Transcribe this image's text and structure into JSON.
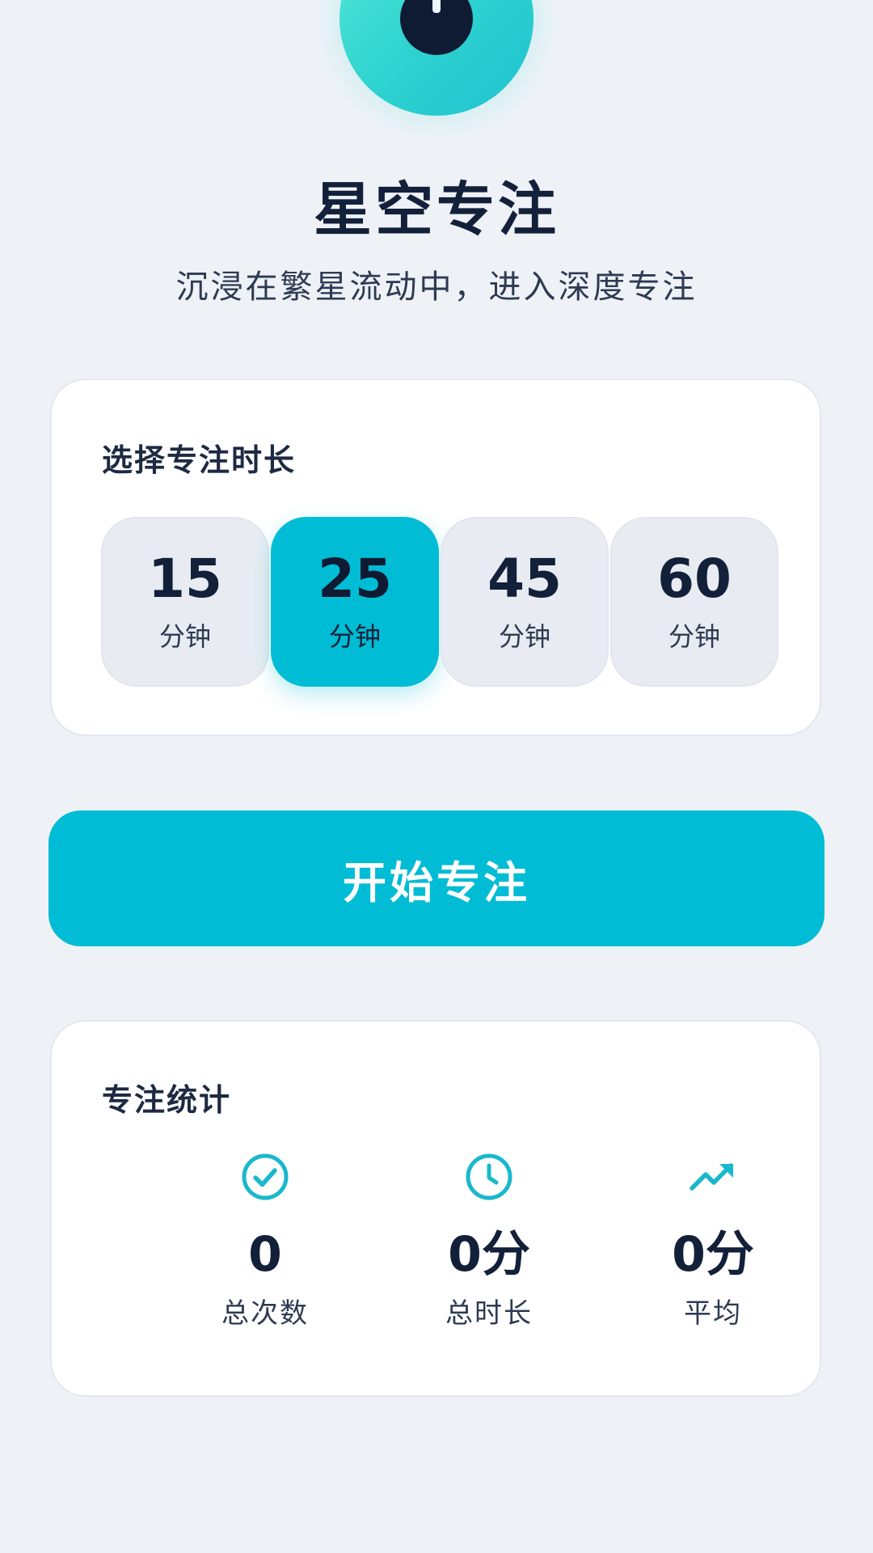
{
  "header": {
    "title": "星空专注",
    "subtitle": "沉浸在繁星流动中，进入深度专注"
  },
  "duration": {
    "title": "选择专注时长",
    "selected_index": 1,
    "options": [
      {
        "value": "15",
        "unit": "分钟"
      },
      {
        "value": "25",
        "unit": "分钟"
      },
      {
        "value": "45",
        "unit": "分钟"
      },
      {
        "value": "60",
        "unit": "分钟"
      }
    ]
  },
  "start_button": {
    "label": "开始专注"
  },
  "stats": {
    "title": "专注统计",
    "items": [
      {
        "icon": "check-circle-icon",
        "value": "0",
        "label": "总次数"
      },
      {
        "icon": "clock-icon",
        "value": "0分",
        "label": "总时长"
      },
      {
        "icon": "trending-up-icon",
        "value": "0分",
        "label": "平均"
      }
    ]
  },
  "colors": {
    "accent": "#00bcd4",
    "background": "#eef2f7",
    "text_dark": "#13203a"
  }
}
